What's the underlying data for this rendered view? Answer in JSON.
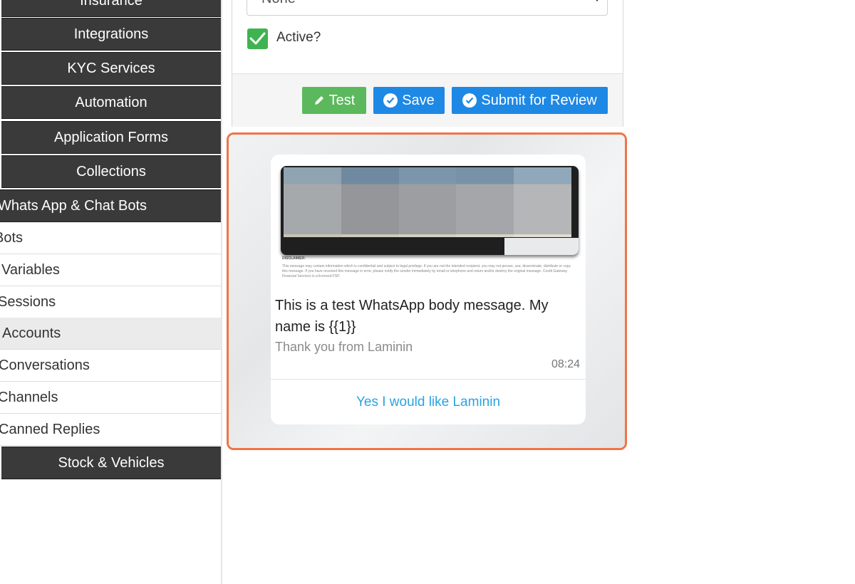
{
  "sidebar": {
    "dark_items": [
      {
        "label": "Insurance"
      },
      {
        "label": "Integrations"
      },
      {
        "label": "KYC Services"
      },
      {
        "label": "Automation"
      },
      {
        "label": "Application Forms"
      },
      {
        "label": "Collections"
      },
      {
        "label": "Whats App & Chat Bots"
      }
    ],
    "sub_items": [
      {
        "label": "Bots"
      },
      {
        "label": "Variables"
      },
      {
        "label": "Sessions"
      },
      {
        "label": "Accounts"
      },
      {
        "label": "Conversations"
      },
      {
        "label": "Channels"
      },
      {
        "label": "Canned Replies"
      }
    ],
    "bottom_item": {
      "label": "Stock & Vehicles"
    }
  },
  "form": {
    "select_value": "None",
    "active_label": "Active?",
    "active_checked": true,
    "buttons": {
      "test": "Test",
      "save": "Save",
      "submit": "Submit for Review"
    }
  },
  "preview": {
    "disclaimer_title": "DISCLAIMER:",
    "disclaimer_text": "This message may contain information which is confidential and subject to legal privilege. If you are not the intended recipient, you may not peruse, use, disseminate, distribute or copy this message. If you have received this message in error, please notify the sender immediately by email or telephone and return and/or destroy the original message. Credit Gateway Financial Services is a licensed FSP.",
    "body": "This is a test WhatsApp body message. My name is {{1}}",
    "footer": "Thank you from Laminin",
    "time": "08:24",
    "quick_reply": "Yes I would like Laminin"
  },
  "colors": {
    "highlight": "#f07445",
    "sidebar_dark": "#3a3a3a",
    "test_button": "#5cb85c",
    "primary_button": "#1e88e5",
    "link": "#2aa3e0"
  }
}
